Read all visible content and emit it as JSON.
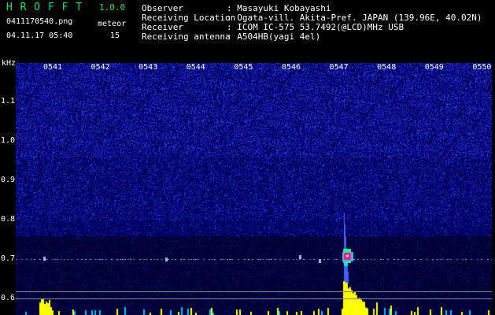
{
  "header": {
    "app_title": "H R O F F T",
    "app_version": "1.0.0",
    "filename": "0411170540.png",
    "meteor_label": "meteor",
    "datetime": "04.11.17 05:40",
    "meteor_count": "15"
  },
  "station": {
    "observer_label": "Observer",
    "observer_value": ": Masayuki Kobayashi",
    "location_label": "Receiving Location",
    "location_value": ": Ogata-vill. Akita-Pref. JAPAN (139.96E, 40.02N)",
    "receiver_label": "Receiver",
    "receiver_value": ": ICOM IC-575 53.7492(@LCD)MHz USB",
    "antenna_label": "Receiving antenna",
    "antenna_value": ": A504HB(yagi 4el)"
  },
  "chart_data": {
    "type": "heatmap",
    "ylabel": "kHz",
    "time_ticks": [
      "0541",
      "0542",
      "0543",
      "0544",
      "0545",
      "0546",
      "0547",
      "0548",
      "0549",
      "0550"
    ],
    "freq_ticks": [
      "1.1",
      "1.0",
      "0.9",
      "0.8",
      "0.7",
      "0.6"
    ],
    "colors": {
      "background": "#000060",
      "noise": "#3040ff",
      "peak": "#ff2080",
      "level": "#ffff00",
      "header_green": "#00e676"
    },
    "events": [
      {
        "time": "0547",
        "freq_khz_top": 0.82,
        "freq_khz_center": 0.7,
        "note_color": "#ff2080"
      }
    ],
    "carrier_freq_khz": 0.7
  }
}
